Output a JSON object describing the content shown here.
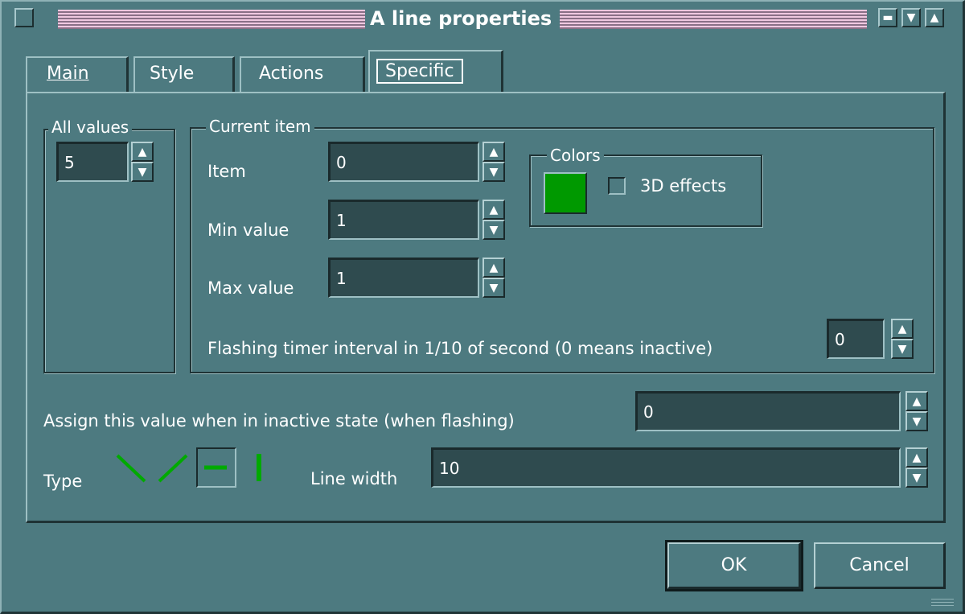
{
  "window": {
    "title": "A line properties"
  },
  "tabs": [
    {
      "label": "Main",
      "active": false
    },
    {
      "label": "Style",
      "active": false
    },
    {
      "label": "Actions",
      "active": false
    },
    {
      "label": "Specific",
      "active": true
    }
  ],
  "all_values": {
    "legend": "All values",
    "value": "5"
  },
  "current_item": {
    "legend": "Current item",
    "item_label": "Item",
    "item_value": "0",
    "min_label": "Min value",
    "min_value": "1",
    "max_label": "Max value",
    "max_value": "1",
    "flash_label": "Flashing timer interval in 1/10 of second (0 means inactive)",
    "flash_value": "0"
  },
  "colors": {
    "legend": "Colors",
    "swatch_color": "#009900",
    "effects_label": "3D effects",
    "effects_checked": false
  },
  "inactive": {
    "label": "Assign this value when in inactive state (when flashing)",
    "value": "0"
  },
  "type": {
    "label": "Type",
    "options": [
      "diagonal-down-icon",
      "diagonal-up-icon",
      "horizontal-line-icon",
      "vertical-line-icon"
    ],
    "selected": "horizontal-line-icon",
    "color": "#00aa00"
  },
  "line_width": {
    "label": "Line width",
    "value": "10"
  },
  "buttons": {
    "ok": "OK",
    "cancel": "Cancel"
  }
}
